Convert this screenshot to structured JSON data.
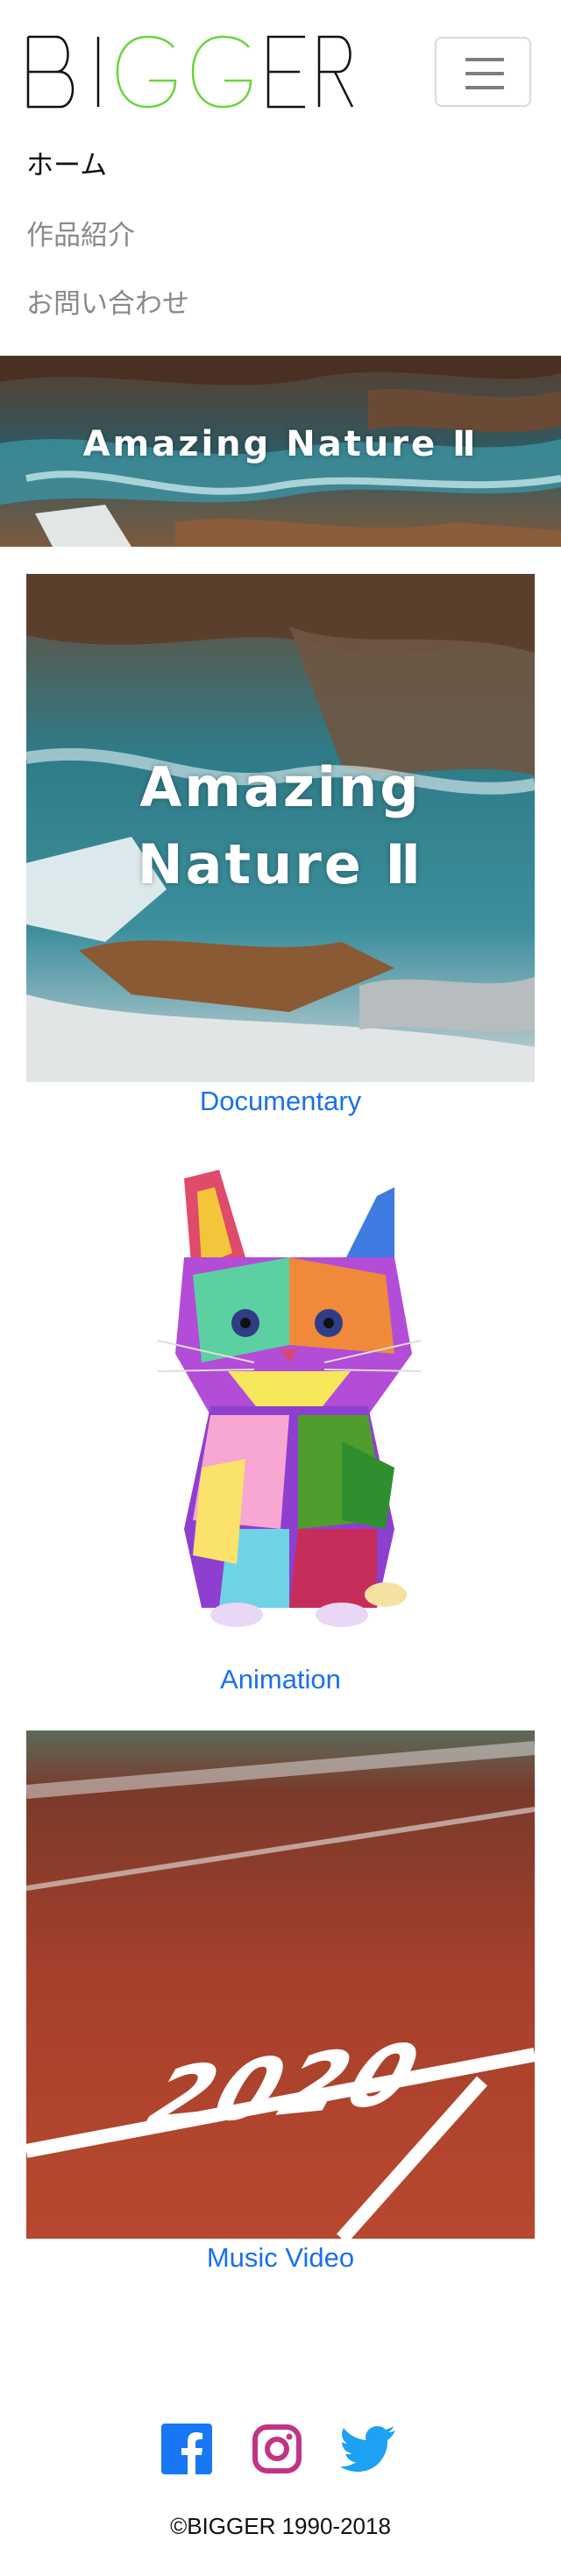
{
  "brand": {
    "logo_text": "BIGGER",
    "accent_color": "#6ad43b"
  },
  "nav": {
    "items": [
      {
        "label": "ホーム",
        "active": true
      },
      {
        "label": "作品紹介",
        "active": false
      },
      {
        "label": "お問い合わせ",
        "active": false
      }
    ]
  },
  "hero": {
    "title": "Amazing Nature Ⅱ"
  },
  "works": [
    {
      "title_line1": "Amazing",
      "title_line2": "Nature Ⅱ",
      "caption": "Documentary"
    },
    {
      "caption": "Animation"
    },
    {
      "overlay_text": "2020",
      "caption": "Music Video"
    }
  ],
  "footer": {
    "social": [
      "facebook-icon",
      "instagram-icon",
      "twitter-icon"
    ],
    "copyright": "©BIGGER 1990-2018"
  },
  "colors": {
    "link": "#1a6ff1",
    "facebook": "#1877f2",
    "instagram": "#c13584",
    "twitter": "#1da1f2"
  }
}
